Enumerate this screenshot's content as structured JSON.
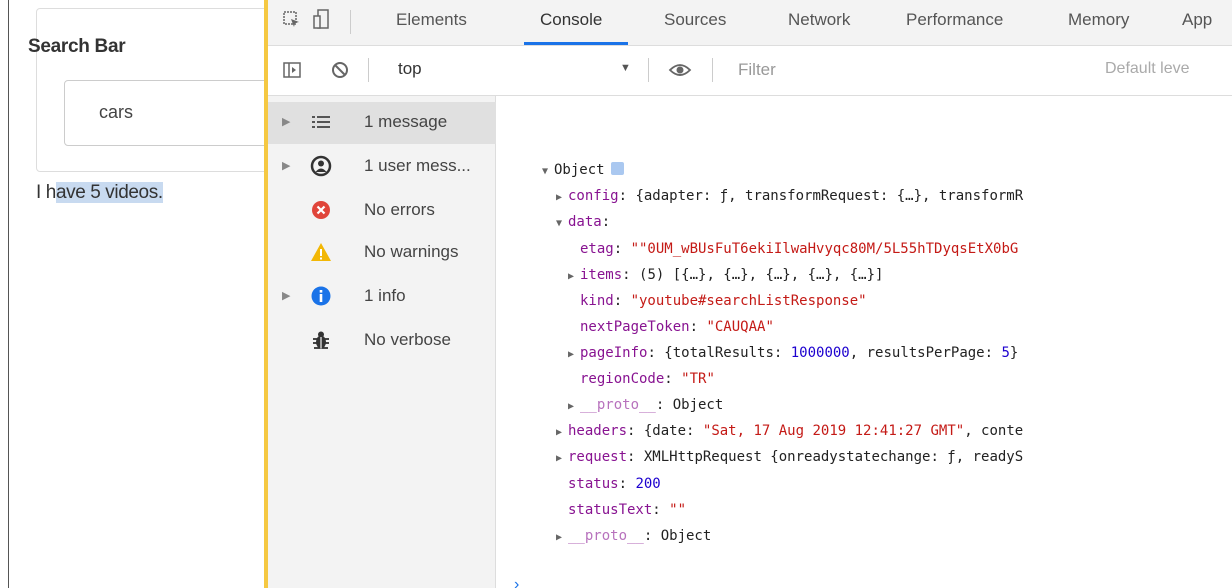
{
  "app": {
    "search_label": "Search Bar",
    "search_value": "cars",
    "videos_prefix": "I h",
    "videos_highlight": "ave 5 videos."
  },
  "devtools": {
    "tabs": [
      "Elements",
      "Console",
      "Sources",
      "Network",
      "Performance",
      "Memory",
      "App"
    ],
    "active_tab": "Console",
    "context": "top",
    "filter_placeholder": "Filter",
    "levels": "Default leve",
    "sidebar": [
      {
        "label": "1 message",
        "icon": "list-icon"
      },
      {
        "label": "1 user mess...",
        "icon": "user-icon"
      },
      {
        "label": "No errors",
        "icon": "error-icon"
      },
      {
        "label": "No warnings",
        "icon": "warning-icon"
      },
      {
        "label": "1 info",
        "icon": "info-icon"
      },
      {
        "label": "No verbose",
        "icon": "bug-icon"
      }
    ],
    "console": {
      "root": "Object",
      "config_key": "config",
      "config_val": "{adapter: ƒ, transformRequest: {…}, transformR",
      "data_key": "data",
      "etag_key": "etag",
      "etag_val": "\"\"0UM_wBUsFuT6ekiIlwaHvyqc80M/5L55hTDyqsEtX0bG",
      "items_key": "items",
      "items_val": "(5) [{…}, {…}, {…}, {…}, {…}]",
      "kind_key": "kind",
      "kind_val": "\"youtube#searchListResponse\"",
      "npt_key": "nextPageToken",
      "npt_val": "\"CAUQAA\"",
      "pageinfo_key": "pageInfo",
      "pageinfo_pre": "{totalResults: ",
      "pageinfo_num1": "1000000",
      "pageinfo_mid": ", resultsPerPage: ",
      "pageinfo_num2": "5",
      "pageinfo_post": "}",
      "region_key": "regionCode",
      "region_val": "\"TR\"",
      "proto_key": "__proto__",
      "proto_val": ": Object",
      "headers_key": "headers",
      "headers_pre": "{date: ",
      "headers_date": "\"Sat, 17 Aug 2019 12:41:27 GMT\"",
      "headers_post": ", conte",
      "request_key": "request",
      "request_val": "XMLHttpRequest {onreadystatechange: ƒ, readyS",
      "status_key": "status",
      "status_val": "200",
      "statustext_key": "statusText",
      "statustext_val": "\"\"",
      "proto2_key": "__proto__",
      "proto2_val": ": Object"
    }
  }
}
